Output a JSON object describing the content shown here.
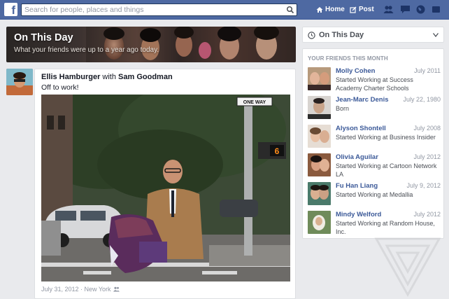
{
  "topbar": {
    "search_placeholder": "Search for people, places and things",
    "home_label": "Home",
    "post_label": "Post"
  },
  "banner": {
    "title": "On This Day",
    "subtitle": "What your friends were up to a year ago today."
  },
  "post": {
    "author": "Ellis Hamburger",
    "with_word": "with",
    "tagged": "Sam Goodman",
    "text": "Off to work!",
    "meta": "July 31, 2012 · New York",
    "sign_text": "ONE WAY"
  },
  "sidebar": {
    "on_this_day_label": "On This Day",
    "friends_title": "YOUR FRIENDS THIS MONTH",
    "friends": [
      {
        "name": "Molly Cohen",
        "date": "July 2011",
        "desc": "Started Working at Success Academy Charter Schools"
      },
      {
        "name": "Jean-Marc Denis",
        "date": "July 22, 1980",
        "desc": "Born"
      },
      {
        "name": "Alyson Shontell",
        "date": "July 2008",
        "desc": "Started Working at Business Insider"
      },
      {
        "name": "Olivia Aguilar",
        "date": "July 2012",
        "desc": "Started Working at Cartoon Network LA"
      },
      {
        "name": "Fu Han Liang",
        "date": "July 9, 2012",
        "desc": "Started Working at Medallia"
      },
      {
        "name": "Mindy Welford",
        "date": "July 2012",
        "desc": "Started Working at Random House, Inc."
      }
    ]
  },
  "colors": {
    "brand": "#4e69a2",
    "link": "#3b5998",
    "muted": "#9197a3"
  }
}
